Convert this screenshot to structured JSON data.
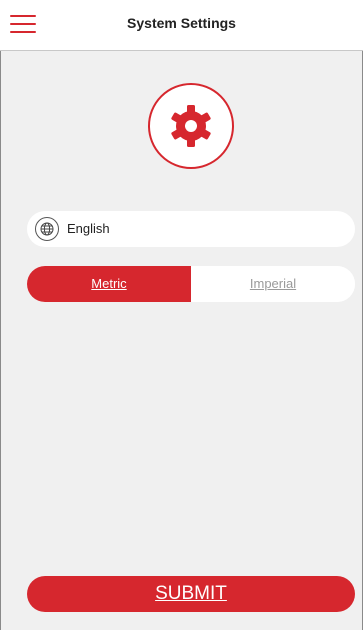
{
  "header": {
    "title": "System Settings",
    "menu_icon": "hamburger-menu-icon"
  },
  "settings_icon": "gear-icon",
  "language": {
    "icon": "globe-icon",
    "value": "English"
  },
  "units": {
    "options": [
      "Metric",
      "Imperial"
    ],
    "selected": "Metric"
  },
  "submit_label": "SUBMIT",
  "colors": {
    "accent": "#d6272e",
    "background": "#f0f0f0",
    "surface": "#ffffff",
    "inactive_text": "#9a9a9a"
  }
}
